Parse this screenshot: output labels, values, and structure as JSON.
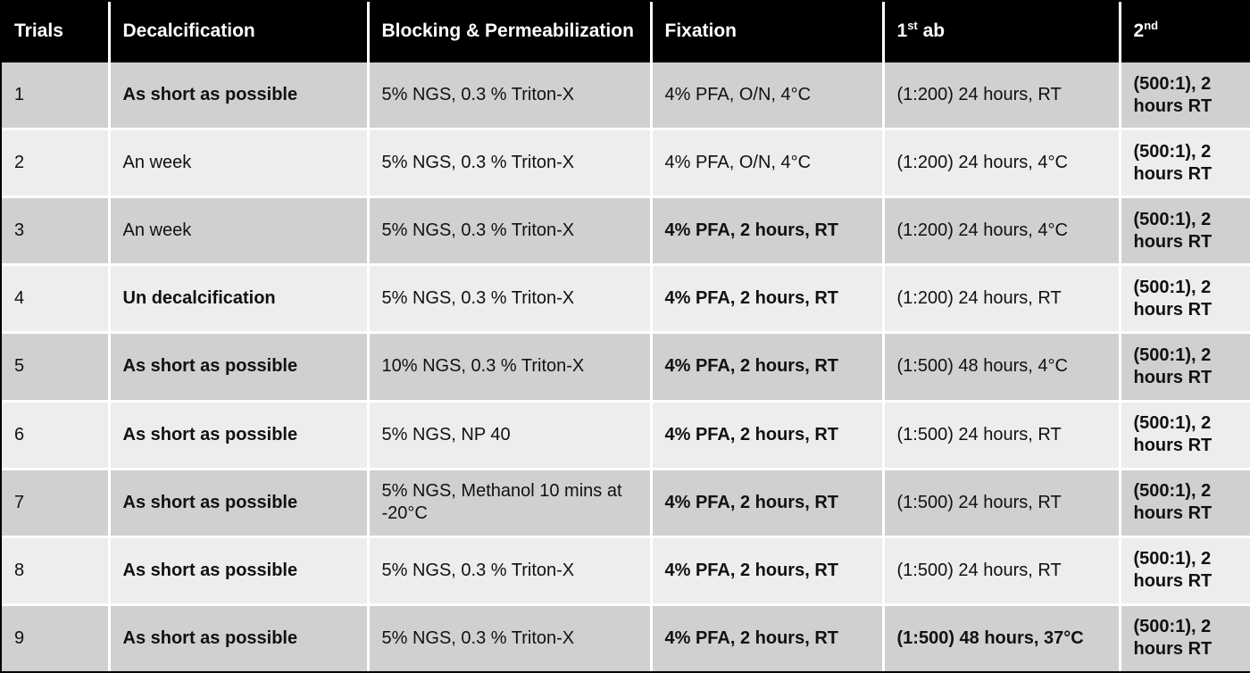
{
  "table": {
    "caption_visible": false,
    "colors": {
      "header_bg": "#000000",
      "header_text": "#ffffff",
      "row_odd_bg": "#d0d0d0",
      "row_even_bg": "#ededed",
      "grid_line": "#ffffff",
      "outer_border": "#000000",
      "cell_text": "#111111"
    },
    "headers": [
      {
        "id": "trials",
        "label": "Trials"
      },
      {
        "id": "decalc",
        "label": "Decalcification"
      },
      {
        "id": "blocking",
        "label": "Blocking & Permeabilization"
      },
      {
        "id": "fixation",
        "label": "Fixation"
      },
      {
        "id": "first_ab",
        "label_pre": "1",
        "label_sup": "st",
        "label_post": " ab"
      },
      {
        "id": "second_ab",
        "label_pre": "2",
        "label_sup": "nd",
        "label_post": ""
      }
    ],
    "rows": [
      {
        "trials": "1",
        "decalcification": "As short as possible",
        "decalcification_bold": true,
        "blocking": "5% NGS, 0.3 % Triton-X",
        "blocking_bold": false,
        "fixation": "4% PFA, O/N, 4°C",
        "fixation_bold": false,
        "first_ab": "(1:200) 24 hours, RT",
        "first_ab_bold": false,
        "second_ab": "(500:1), 2 hours RT",
        "second_ab_bold": true
      },
      {
        "trials": "2",
        "decalcification": "An week",
        "decalcification_bold": false,
        "blocking": "5% NGS, 0.3 % Triton-X",
        "blocking_bold": false,
        "fixation": "4% PFA, O/N, 4°C",
        "fixation_bold": false,
        "first_ab": "(1:200) 24 hours, 4°C",
        "first_ab_bold": false,
        "second_ab": "(500:1), 2 hours RT",
        "second_ab_bold": true
      },
      {
        "trials": "3",
        "decalcification": "An week",
        "decalcification_bold": false,
        "blocking": "5% NGS, 0.3 % Triton-X",
        "blocking_bold": false,
        "fixation": "4% PFA, 2 hours, RT",
        "fixation_bold": true,
        "first_ab": "(1:200) 24 hours, 4°C",
        "first_ab_bold": false,
        "second_ab": "(500:1), 2 hours RT",
        "second_ab_bold": true
      },
      {
        "trials": "4",
        "decalcification": "Un decalcification",
        "decalcification_bold": true,
        "blocking": "5% NGS, 0.3 % Triton-X",
        "blocking_bold": false,
        "fixation": "4% PFA, 2 hours, RT",
        "fixation_bold": true,
        "first_ab": "(1:200) 24 hours, RT",
        "first_ab_bold": false,
        "second_ab": "(500:1), 2 hours RT",
        "second_ab_bold": true
      },
      {
        "trials": "5",
        "decalcification": "As short as possible",
        "decalcification_bold": true,
        "blocking": "10% NGS, 0.3 % Triton-X",
        "blocking_bold": false,
        "fixation": "4% PFA, 2 hours, RT",
        "fixation_bold": true,
        "first_ab": "(1:500) 48 hours, 4°C",
        "first_ab_bold": false,
        "second_ab": "(500:1), 2 hours RT",
        "second_ab_bold": true
      },
      {
        "trials": "6",
        "decalcification": "As short as possible",
        "decalcification_bold": true,
        "blocking": "5% NGS, NP 40",
        "blocking_bold": false,
        "fixation": "4% PFA, 2 hours, RT",
        "fixation_bold": true,
        "first_ab": "(1:500) 24 hours, RT",
        "first_ab_bold": false,
        "second_ab": "(500:1), 2 hours RT",
        "second_ab_bold": true
      },
      {
        "trials": "7",
        "decalcification": "As short as possible",
        "decalcification_bold": true,
        "blocking": "5% NGS, Methanol 10 mins at -20°C",
        "blocking_bold": false,
        "fixation": "4% PFA, 2 hours, RT",
        "fixation_bold": true,
        "first_ab": "(1:500) 24 hours, RT",
        "first_ab_bold": false,
        "second_ab": "(500:1), 2 hours RT",
        "second_ab_bold": true
      },
      {
        "trials": "8",
        "decalcification": "As short as possible",
        "decalcification_bold": true,
        "blocking": "5% NGS, 0.3 % Triton-X",
        "blocking_bold": false,
        "fixation": "4% PFA, 2 hours, RT",
        "fixation_bold": true,
        "first_ab": "(1:500) 24 hours, RT",
        "first_ab_bold": false,
        "second_ab": "(500:1), 2 hours RT",
        "second_ab_bold": true
      },
      {
        "trials": "9",
        "decalcification": "As short as possible",
        "decalcification_bold": true,
        "blocking": "5% NGS, 0.3 % Triton-X",
        "blocking_bold": false,
        "fixation": "4% PFA, 2 hours, RT",
        "fixation_bold": true,
        "first_ab": "(1:500) 48 hours, 37°C",
        "first_ab_bold": true,
        "second_ab": "(500:1), 2 hours RT",
        "second_ab_bold": true
      }
    ]
  }
}
